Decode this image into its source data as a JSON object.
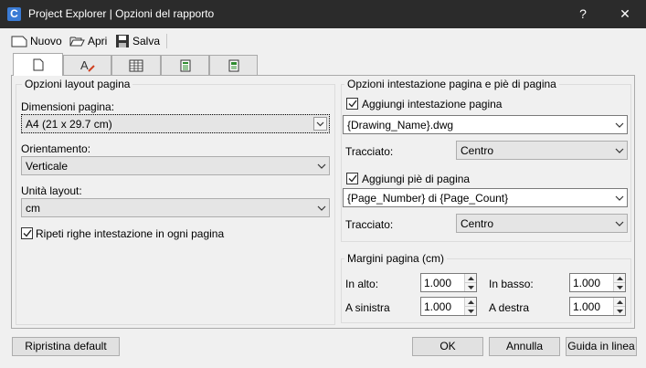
{
  "window": {
    "title": "Project Explorer | Opzioni del rapporto",
    "app_icon_letter": "C",
    "help_glyph": "?",
    "close_glyph": "✕"
  },
  "toolbar": {
    "new_label": "Nuovo",
    "open_label": "Apri",
    "save_label": "Salva"
  },
  "tabs": [
    "page-layout",
    "text-format",
    "table",
    "calculator",
    "report"
  ],
  "layout_group": {
    "title": "Opzioni layout pagina",
    "page_size_label": "Dimensioni pagina:",
    "page_size_value": "A4 (21 x 29.7 cm)",
    "orientation_label": "Orientamento:",
    "orientation_value": "Verticale",
    "unit_label": "Unità layout:",
    "unit_value": "cm",
    "repeat_header_label": "Ripeti righe intestazione in ogni pagina",
    "repeat_header_checked": true
  },
  "header_footer_group": {
    "title": "Opzioni intestazione pagina e piè di pagina",
    "add_header_label": "Aggiungi intestazione pagina",
    "add_header_checked": true,
    "header_value": "{Drawing_Name}.dwg",
    "header_layout_label": "Tracciato:",
    "header_layout_value": "Centro",
    "add_footer_label": "Aggiungi piè di pagina",
    "add_footer_checked": true,
    "footer_value": "{Page_Number} di {Page_Count}",
    "footer_layout_label": "Tracciato:",
    "footer_layout_value": "Centro"
  },
  "margins_group": {
    "title": "Margini pagina (cm)",
    "top_label": "In alto:",
    "top_value": "1.000",
    "bottom_label": "In basso:",
    "bottom_value": "1.000",
    "left_label": "A sinistra",
    "left_value": "1.000",
    "right_label": "A destra",
    "right_value": "1.000"
  },
  "footer_buttons": {
    "reset_label": "Ripristina default",
    "ok_label": "OK",
    "cancel_label": "Annulla",
    "help_label": "Guida in linea"
  },
  "colors": {
    "titlebar": "#2b2b2b",
    "dialog_bg": "#f0f0f0",
    "app_icon": "#3a7bd5"
  }
}
